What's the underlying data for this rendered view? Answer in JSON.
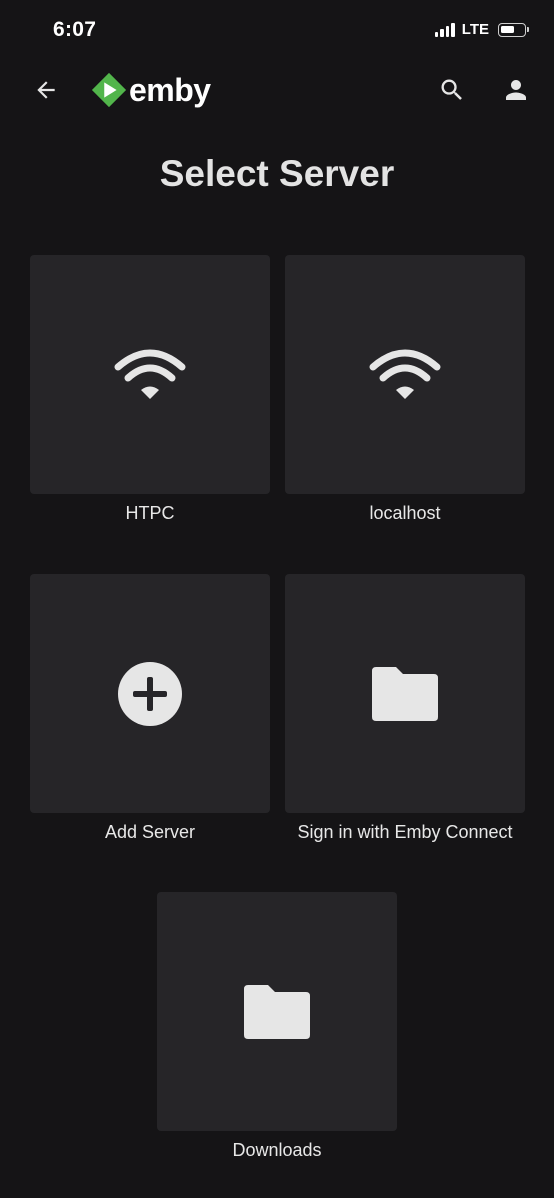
{
  "status_bar": {
    "time": "6:07",
    "network": "LTE"
  },
  "header": {
    "logo_text": "emby",
    "icons": [
      "back-arrow-icon",
      "emby-logo-icon",
      "search-icon",
      "account-icon"
    ]
  },
  "page": {
    "title": "Select Server"
  },
  "servers": [
    {
      "label": "HTPC",
      "icon": "wifi-icon"
    },
    {
      "label": "localhost",
      "icon": "wifi-icon"
    },
    {
      "label": "Add Server",
      "icon": "add-circle-icon"
    },
    {
      "label": "Sign in with Emby Connect",
      "icon": "folder-icon"
    },
    {
      "label": "Downloads",
      "icon": "folder-icon"
    }
  ],
  "colors": {
    "background": "#151416",
    "tile": "#262528",
    "brand_green": "#52b54b",
    "icon": "#e6e6e6"
  }
}
